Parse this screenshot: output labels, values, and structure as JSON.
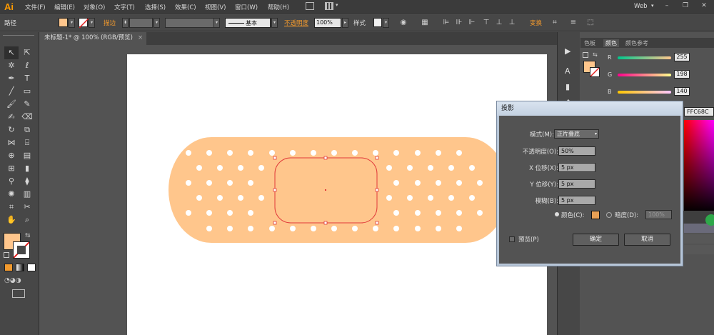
{
  "app": {
    "logo": "Ai",
    "menus": [
      "文件(F)",
      "编辑(E)",
      "对象(O)",
      "文字(T)",
      "选择(S)",
      "效果(C)",
      "视图(V)",
      "窗口(W)",
      "帮助(H)"
    ],
    "workspace": "Web",
    "workspace_arrow": "▾",
    "window_controls": {
      "minimize": "–",
      "restore": "❐",
      "close": "✕"
    }
  },
  "control_bar": {
    "object_type": "路径",
    "stroke_label": "描边",
    "stroke_style": "基本",
    "opacity_label": "不透明度",
    "opacity_value": "100%",
    "style_label": "样式",
    "transform_label": "变换"
  },
  "document": {
    "tab_title": "未标题-1* @ 100% (RGB/预览)",
    "tab_close": "×"
  },
  "colors": {
    "fill": "#FFC68C",
    "bandage": "#FFC68C",
    "selection": "#e03a3a",
    "accent": "#f29a2e"
  },
  "color_panel": {
    "tabs": [
      "色板",
      "颜色",
      "颜色参考"
    ],
    "channels": [
      {
        "label": "R",
        "value": "255"
      },
      {
        "label": "G",
        "value": "198"
      },
      {
        "label": "B",
        "value": "140"
      }
    ],
    "hex": "FFC68C"
  },
  "dialog": {
    "title": "投影",
    "mode_label": "模式(M):",
    "mode_value": "正片叠底",
    "opacity_label": "不透明度(O):",
    "opacity_value": "50%",
    "x_label": "X 位移(X):",
    "x_value": "5 px",
    "y_label": "Y 位移(Y):",
    "y_value": "5 px",
    "blur_label": "模糊(B):",
    "blur_value": "5 px",
    "color_label": "颜色(C):",
    "darkness_label": "暗度(D):",
    "darkness_value": "100%",
    "preview_label": "预览(P)",
    "ok_label": "确定",
    "cancel_label": "取消"
  }
}
